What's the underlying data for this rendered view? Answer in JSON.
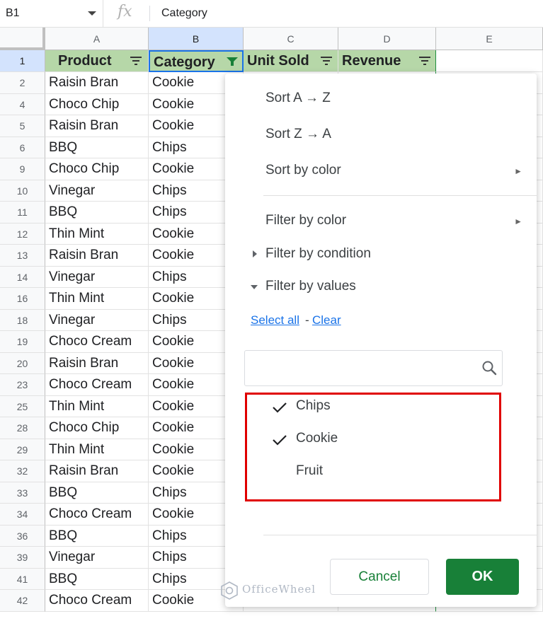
{
  "formula_bar": {
    "name_box": "B1",
    "fx": "fx",
    "content": "Category"
  },
  "columns": [
    "A",
    "B",
    "C",
    "D",
    "E"
  ],
  "header_row": {
    "row_number": "1",
    "cells": [
      "Product",
      "Category",
      "Unit Sold",
      "Revenue",
      ""
    ]
  },
  "rows": [
    {
      "num": "2",
      "product": "Raisin Bran",
      "category": "Cookie"
    },
    {
      "num": "4",
      "product": "Choco Chip",
      "category": "Cookie"
    },
    {
      "num": "5",
      "product": "Raisin Bran",
      "category": "Cookie"
    },
    {
      "num": "6",
      "product": "BBQ",
      "category": "Chips"
    },
    {
      "num": "9",
      "product": "Choco Chip",
      "category": "Cookie"
    },
    {
      "num": "10",
      "product": "Vinegar",
      "category": "Chips"
    },
    {
      "num": "11",
      "product": "BBQ",
      "category": "Chips"
    },
    {
      "num": "12",
      "product": "Thin Mint",
      "category": "Cookie"
    },
    {
      "num": "13",
      "product": "Raisin Bran",
      "category": "Cookie"
    },
    {
      "num": "14",
      "product": "Vinegar",
      "category": "Chips"
    },
    {
      "num": "16",
      "product": "Thin Mint",
      "category": "Cookie"
    },
    {
      "num": "18",
      "product": "Vinegar",
      "category": "Chips"
    },
    {
      "num": "19",
      "product": "Choco Cream",
      "category": "Cookie"
    },
    {
      "num": "20",
      "product": "Raisin Bran",
      "category": "Cookie"
    },
    {
      "num": "23",
      "product": "Choco Cream",
      "category": "Cookie"
    },
    {
      "num": "25",
      "product": "Thin Mint",
      "category": "Cookie"
    },
    {
      "num": "28",
      "product": "Choco Chip",
      "category": "Cookie"
    },
    {
      "num": "29",
      "product": "Thin Mint",
      "category": "Cookie"
    },
    {
      "num": "32",
      "product": "Raisin Bran",
      "category": "Cookie"
    },
    {
      "num": "33",
      "product": "BBQ",
      "category": "Chips"
    },
    {
      "num": "34",
      "product": "Choco Cream",
      "category": "Cookie"
    },
    {
      "num": "36",
      "product": "BBQ",
      "category": "Chips"
    },
    {
      "num": "39",
      "product": "Vinegar",
      "category": "Chips"
    },
    {
      "num": "41",
      "product": "BBQ",
      "category": "Chips"
    },
    {
      "num": "42",
      "product": "Choco Cream",
      "category": "Cookie"
    }
  ],
  "menu": {
    "sort_az": "Sort A → Z",
    "sort_za": "Sort Z → A",
    "sort_by_color": "Sort by color",
    "filter_by_color": "Filter by color",
    "filter_by_condition": "Filter by condition",
    "filter_by_values": "Filter by values",
    "select_all": "Select all",
    "link_separator": "-",
    "clear": "Clear",
    "search_value": "",
    "values": [
      {
        "label": "Chips",
        "checked": true
      },
      {
        "label": "Cookie",
        "checked": true
      },
      {
        "label": "Fruit",
        "checked": false
      }
    ],
    "cancel": "Cancel",
    "ok": "OK"
  },
  "watermark": "OfficeWheel",
  "colors": {
    "header_fill": "#b6d7a8",
    "ok_button": "#188038",
    "highlight_box": "#e00000",
    "link": "#1a73e8"
  }
}
